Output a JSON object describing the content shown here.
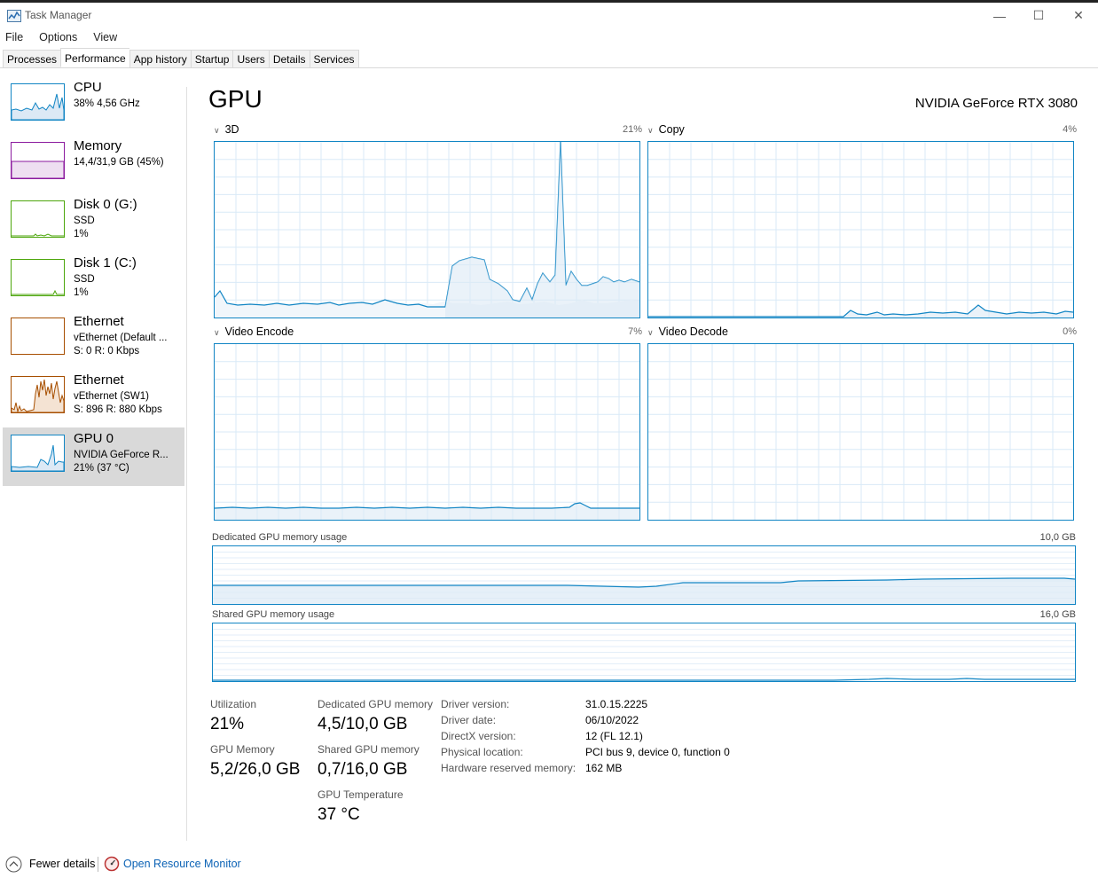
{
  "window": {
    "title": "Task Manager",
    "minimize": "—",
    "maximize": "☐",
    "close": "✕"
  },
  "menu": [
    "File",
    "Options",
    "View"
  ],
  "tabs": [
    "Processes",
    "Performance",
    "App history",
    "Startup",
    "Users",
    "Details",
    "Services"
  ],
  "sidebar": [
    {
      "title": "CPU",
      "line1": "38% 4,56 GHz",
      "line2": "",
      "color": "#1185c4"
    },
    {
      "title": "Memory",
      "line1": "14,4/31,9 GB (45%)",
      "line2": "",
      "color": "#8b1a9e"
    },
    {
      "title": "Disk 0 (G:)",
      "line1": "SSD",
      "line2": "1%",
      "color": "#4da60c"
    },
    {
      "title": "Disk 1 (C:)",
      "line1": "SSD",
      "line2": "1%",
      "color": "#4da60c"
    },
    {
      "title": "Ethernet",
      "line1": "vEthernet (Default ...",
      "line2": "S: 0 R: 0 Kbps",
      "color": "#a74f01"
    },
    {
      "title": "Ethernet",
      "line1": "vEthernet (SW1)",
      "line2": "S: 896 R: 880 Kbps",
      "color": "#a74f01"
    },
    {
      "title": "GPU 0",
      "line1": "NVIDIA GeForce R...",
      "line2": "21% (37 °C)",
      "color": "#1185c4"
    }
  ],
  "main": {
    "title": "GPU",
    "gpu_name": "NVIDIA GeForce RTX 3080",
    "engines": [
      {
        "name": "3D",
        "percent": "21%"
      },
      {
        "name": "Copy",
        "percent": "4%"
      },
      {
        "name": "Video Encode",
        "percent": "7%"
      },
      {
        "name": "Video Decode",
        "percent": "0%"
      }
    ],
    "dedicated_label": "Dedicated GPU memory usage",
    "dedicated_max": "10,0 GB",
    "shared_label": "Shared GPU memory usage",
    "shared_max": "16,0 GB"
  },
  "stats": {
    "utilization_label": "Utilization",
    "utilization_value": "21%",
    "dedicated_label": "Dedicated GPU memory",
    "dedicated_value": "4,5/10,0 GB",
    "gpu_memory_label": "GPU Memory",
    "gpu_memory_value": "5,2/26,0 GB",
    "shared_label": "Shared GPU memory",
    "shared_value": "0,7/16,0 GB",
    "temp_label": "GPU Temperature",
    "temp_value": "37 °C"
  },
  "info": [
    {
      "key": "Driver version:",
      "value": "31.0.15.2225"
    },
    {
      "key": "Driver date:",
      "value": "06/10/2022"
    },
    {
      "key": "DirectX version:",
      "value": "12 (FL 12.1)"
    },
    {
      "key": "Physical location:",
      "value": "PCI bus 9, device 0, function 0"
    },
    {
      "key": "Hardware reserved memory:",
      "value": "162 MB"
    }
  ],
  "footer": {
    "fewer_details": "Fewer details",
    "resource_monitor": "Open Resource Monitor"
  },
  "colors": {
    "accent": "#1185c4",
    "link": "#0b62b5",
    "selected_bg": "#d9d9d9"
  }
}
